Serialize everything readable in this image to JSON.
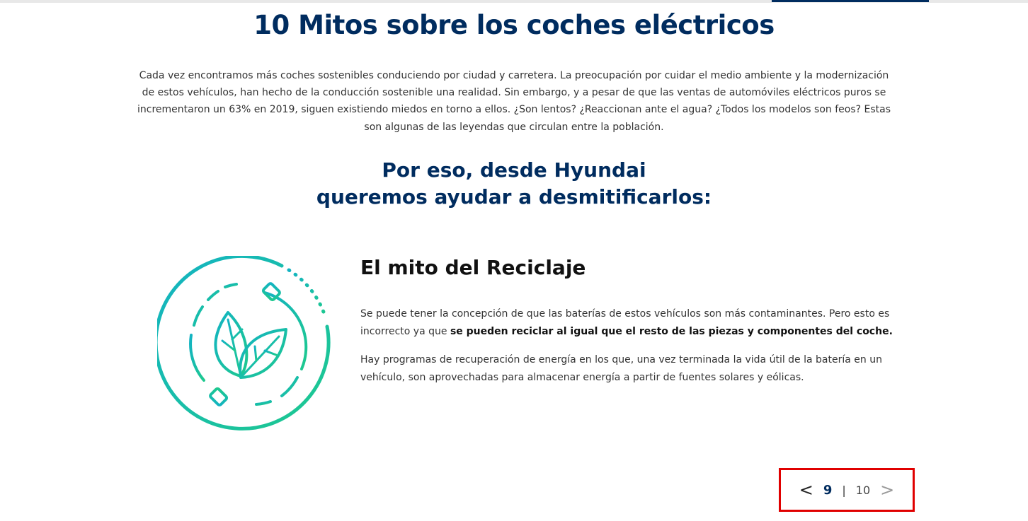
{
  "page": {
    "title": "10 Mitos sobre los coches eléctricos",
    "intro": "Cada vez encontramos más coches sostenibles conduciendo por ciudad y carretera. La preocupación por cuidar el medio ambiente y la modernización de estos vehículos, han hecho de la conducción sostenible una realidad. Sin embargo, y a pesar de que las ventas de automóviles eléctricos puros se incrementaron un 63% en 2019, siguen existiendo miedos en torno a ellos. ¿Son lentos? ¿Reaccionan ante el agua? ¿Todos los modelos son feos? Estas son algunas de las leyendas que circulan entre la población.",
    "subheading_line1": "Por eso, desde Hyundai",
    "subheading_line2": "queremos ayudar a desmitificarlos:"
  },
  "myth": {
    "icon": "recycle-leaf-plug-icon",
    "title": "El mito del Reciclaje",
    "p1_text": "Se puede tener la concepción de que las baterías de estos vehículos son más contaminantes. Pero esto es incorrecto ya que ",
    "p1_bold": "se pueden reciclar al igual que el resto de las piezas y componentes del coche.",
    "p2": "Hay programas de recuperación de energía en los que, una vez terminada la vida útil de la batería en un vehículo, son aprovechadas para almacenar energía a partir de fuentes solares y eólicas."
  },
  "pager": {
    "prev": "<",
    "current": "9",
    "separator": "|",
    "total": "10",
    "next": ">"
  },
  "colors": {
    "brand_navy": "#002c5f",
    "icon_teal": "#1bb5b0",
    "highlight_red": "#e00000"
  }
}
